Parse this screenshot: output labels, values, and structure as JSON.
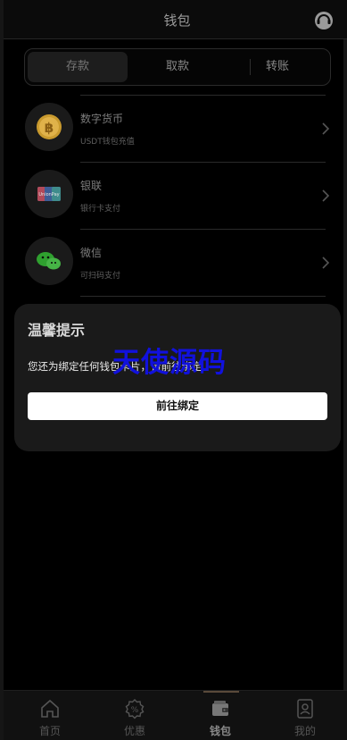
{
  "header": {
    "title": "钱包",
    "service_icon": "customer-service-icon"
  },
  "tabs": [
    {
      "label": "存款",
      "active": true
    },
    {
      "label": "取款",
      "active": false
    },
    {
      "label": "转账",
      "active": false
    }
  ],
  "payments": [
    {
      "name": "数字货币",
      "sub": "USDT钱包充值",
      "icon": "bitcoin-icon"
    },
    {
      "name": "银联",
      "sub": "银行卡支付",
      "icon": "unionpay-icon"
    },
    {
      "name": "微信",
      "sub": "可扫码支付",
      "icon": "wechat-icon"
    }
  ],
  "modal": {
    "title": "温馨提示",
    "message": "您还为绑定任何钱包卡片，请前往绑定",
    "button": "前往绑定"
  },
  "watermark": "天使源码",
  "bottom_nav": [
    {
      "label": "首页",
      "icon": "home-icon"
    },
    {
      "label": "优惠",
      "icon": "discount-icon"
    },
    {
      "label": "钱包",
      "icon": "wallet-icon",
      "active": true
    },
    {
      "label": "我的",
      "icon": "profile-icon"
    }
  ],
  "colors": {
    "background": "#000000",
    "modal": "#1a1a1a",
    "watermark": "#1111dd"
  }
}
